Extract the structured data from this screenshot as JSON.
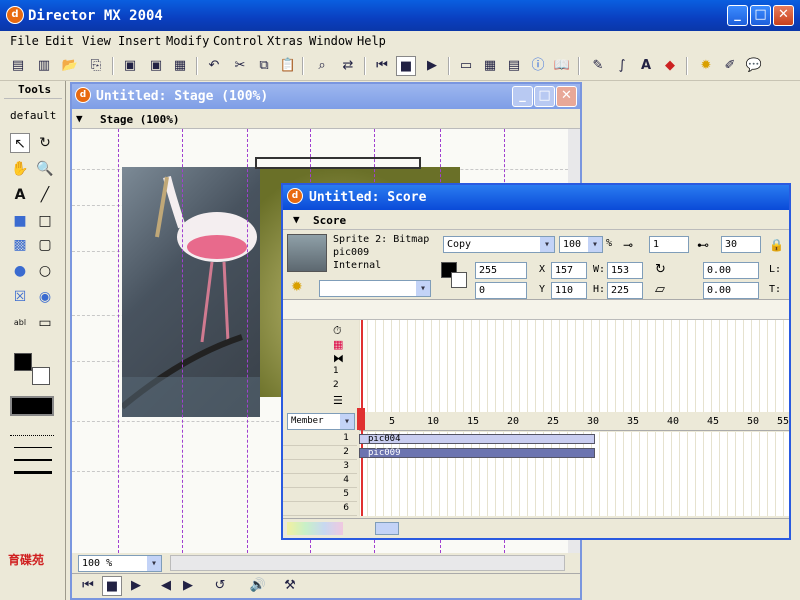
{
  "app": {
    "title": "Director MX 2004",
    "logo_glyph": "d"
  },
  "window_buttons": {
    "minimize": "_",
    "maximize": "□",
    "close": "✕"
  },
  "menu": [
    "File",
    "Edit",
    "View",
    "Insert",
    "Modify",
    "Control",
    "Xtras",
    "Window",
    "Help"
  ],
  "tools": {
    "title": "Tools",
    "mode": "default"
  },
  "stage": {
    "title": "Untitled: Stage (100%)",
    "panel": "Stage (100%)",
    "zoom": "100 %"
  },
  "score": {
    "title": "Untitled: Score",
    "panel": "Score",
    "sprite_info": {
      "line1": "Sprite 2: Bitmap",
      "line2": "pic009",
      "line3": "Internal"
    },
    "ink": "Copy",
    "blend": "100",
    "blend_unit": "%",
    "start_frame": "1",
    "end_frame": "30",
    "color_fore": "255",
    "color_back": "0",
    "x_label": "X",
    "x": "157",
    "y_label": "Y",
    "y": "110",
    "w_label": "W:",
    "w": "153",
    "h_label": "H:",
    "h": "225",
    "rotation": "0.00",
    "skew": "0.00",
    "l_label": "L:",
    "t_label": "T:",
    "channel_select": "Member",
    "frame_numbers": [
      "5",
      "10",
      "15",
      "20",
      "25",
      "30",
      "35",
      "40",
      "45",
      "50",
      "55"
    ],
    "effect_channels": [
      "1",
      "2"
    ],
    "sprite_channels": [
      "1",
      "2",
      "3",
      "4",
      "5",
      "6"
    ],
    "sprites": [
      {
        "name": "pic004",
        "start": 1,
        "end": 30
      },
      {
        "name": "pic009",
        "start": 1,
        "end": 30
      }
    ]
  },
  "watermark": "育碟苑"
}
